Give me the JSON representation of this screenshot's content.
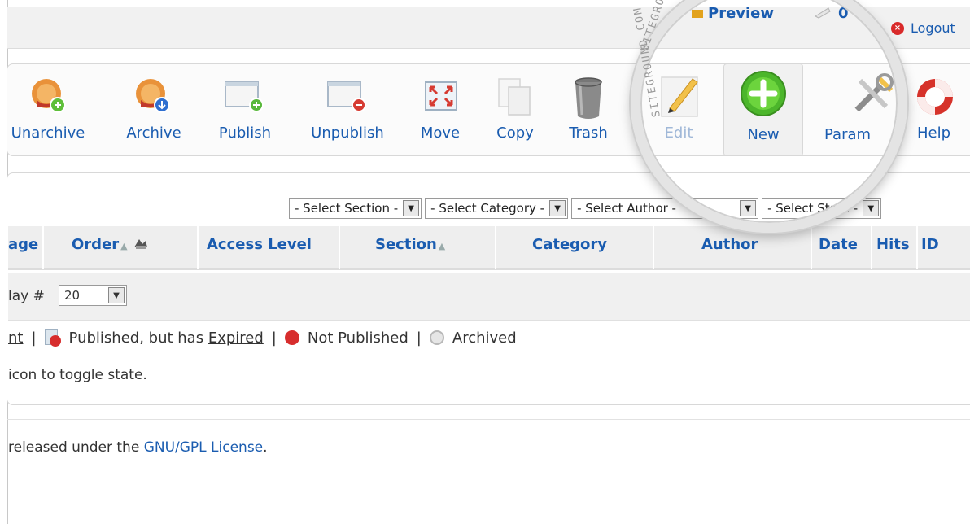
{
  "header": {
    "preview_label": "Preview",
    "messages_label": "0",
    "logout_label": "Logout"
  },
  "toolbar": {
    "buttons": [
      {
        "label": "Unarchive",
        "icon": "unarchive-icon"
      },
      {
        "label": "Archive",
        "icon": "archive-icon"
      },
      {
        "label": "Publish",
        "icon": "publish-icon"
      },
      {
        "label": "Unpublish",
        "icon": "unpublish-icon"
      },
      {
        "label": "Move",
        "icon": "move-icon"
      },
      {
        "label": "Copy",
        "icon": "copy-icon"
      },
      {
        "label": "Trash",
        "icon": "trash-icon"
      },
      {
        "label": "Edit",
        "icon": "edit-icon"
      },
      {
        "label": "New",
        "icon": "new-icon"
      },
      {
        "label": "Param",
        "icon": "parameters-icon"
      },
      {
        "label": "Help",
        "icon": "help-icon"
      }
    ]
  },
  "filters": {
    "section": "- Select Section -",
    "category": "- Select Category -",
    "author": "- Select Author -",
    "state": "- Select State -"
  },
  "table": {
    "columns": [
      "age",
      "Order",
      "Access Level",
      "Section",
      "Category",
      "Author",
      "Date",
      "Hits",
      "ID"
    ]
  },
  "pager": {
    "label": "lay #",
    "value": "20"
  },
  "legend": {
    "prefix": "nt",
    "sep": "|",
    "expired_text": "Published, but has",
    "expired_link": "Expired",
    "not_published": "Not Published",
    "archived": "Archived",
    "hint": "icon to toggle state."
  },
  "footer": {
    "text": "released under the",
    "link": "GNU/GPL License",
    "end": "."
  },
  "watermark": {
    "line1": "SITEGROUND.COM",
    "line2": "SITEGROUND.COM"
  },
  "colors": {
    "link": "#1a5cb0",
    "toolbar_bg": "#fbfbfb",
    "header_bg": "#eeeeee",
    "new_green": "#4cb62b",
    "help_red": "#d6322a"
  }
}
